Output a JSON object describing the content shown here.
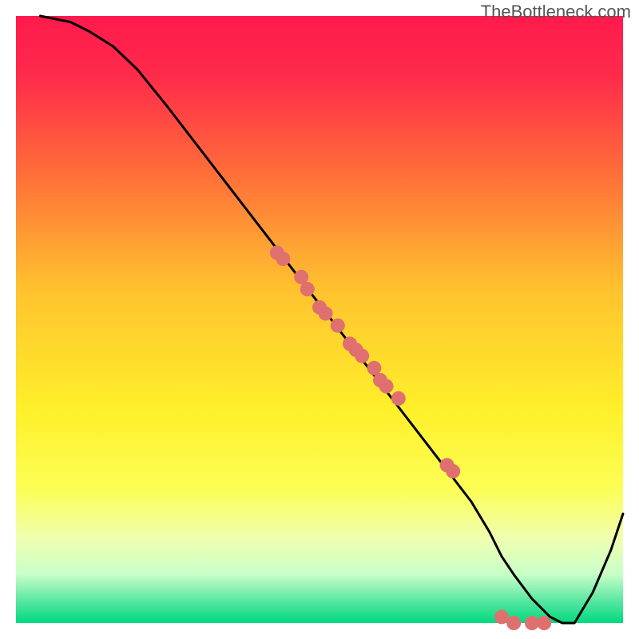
{
  "watermark": "TheBottleneck.com",
  "chart_data": {
    "type": "line",
    "title": "",
    "xlabel": "",
    "ylabel": "",
    "xlim": [
      0,
      100
    ],
    "ylim": [
      0,
      100
    ],
    "grid": false,
    "background": {
      "type": "gradient-vertical-performance",
      "stops": [
        {
          "offset": 0.0,
          "color": "#ff1a4d"
        },
        {
          "offset": 0.1,
          "color": "#ff2b4a"
        },
        {
          "offset": 0.25,
          "color": "#ff6a3a"
        },
        {
          "offset": 0.45,
          "color": "#ffc22e"
        },
        {
          "offset": 0.65,
          "color": "#fff02a"
        },
        {
          "offset": 0.78,
          "color": "#fbff55"
        },
        {
          "offset": 0.86,
          "color": "#f0ffb0"
        },
        {
          "offset": 0.92,
          "color": "#c8ffc8"
        },
        {
          "offset": 0.965,
          "color": "#55e6a0"
        },
        {
          "offset": 1.0,
          "color": "#00d980"
        }
      ]
    },
    "series": [
      {
        "name": "bottleneck-curve",
        "color": "#000000",
        "x": [
          4,
          9,
          12,
          16,
          20,
          25,
          30,
          35,
          40,
          45,
          50,
          55,
          60,
          65,
          70,
          75,
          78,
          80,
          82,
          85,
          88,
          90,
          92,
          95,
          98,
          100
        ],
        "values": [
          100,
          99,
          97.5,
          95,
          91.2,
          85,
          78.5,
          72,
          65.5,
          59,
          52.5,
          46,
          39.5,
          33,
          26.5,
          20,
          15,
          11,
          8,
          4,
          1,
          0,
          0,
          5,
          12,
          18
        ]
      }
    ],
    "points": {
      "name": "data-points",
      "color": "#e07070",
      "radius": 9,
      "x": [
        43,
        44,
        47,
        48,
        50,
        51,
        53,
        55,
        56,
        57,
        59,
        60,
        61,
        63,
        71,
        72,
        80,
        82,
        85,
        87
      ],
      "values": [
        61,
        60,
        57,
        55,
        52,
        51,
        49,
        46,
        45,
        44,
        42,
        40,
        39,
        37,
        26,
        25,
        1,
        0,
        0,
        0
      ]
    }
  }
}
